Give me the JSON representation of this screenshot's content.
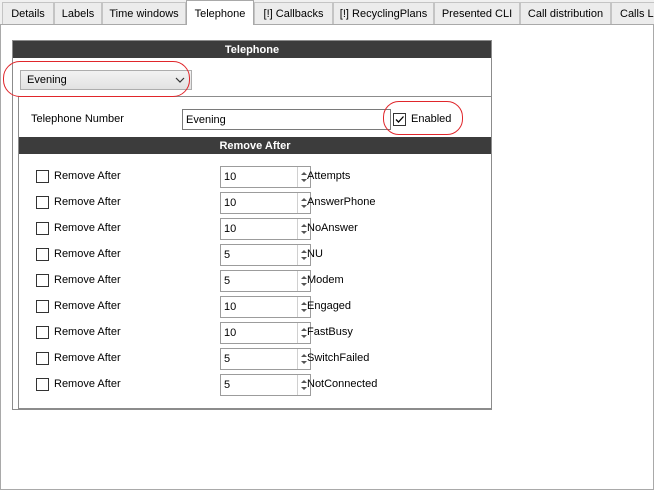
{
  "tabs": [
    {
      "label": "Details"
    },
    {
      "label": "Labels"
    },
    {
      "label": "Time windows"
    },
    {
      "label": "Telephone"
    },
    {
      "label": "[!] Callbacks"
    },
    {
      "label": "[!] RecyclingPlans"
    },
    {
      "label": "Presented CLI"
    },
    {
      "label": "Call distribution"
    },
    {
      "label": "Calls Li"
    }
  ],
  "active_tab": "Telephone",
  "panel": {
    "title": "Telephone",
    "schedule_select": "Evening",
    "telephone_number_label": "Telephone Number",
    "telephone_number_value": "Evening",
    "enabled_label": "Enabled",
    "enabled_checked": true,
    "remove_after_title": "Remove After"
  },
  "remove_after_rows": [
    {
      "label": "Remove After",
      "value": "10",
      "unit": "Attempts"
    },
    {
      "label": "Remove After",
      "value": "10",
      "unit": "AnswerPhone"
    },
    {
      "label": "Remove After",
      "value": "10",
      "unit": "NoAnswer"
    },
    {
      "label": "Remove After",
      "value": "5",
      "unit": "NU"
    },
    {
      "label": "Remove After",
      "value": "5",
      "unit": "Modem"
    },
    {
      "label": "Remove After",
      "value": "10",
      "unit": "Engaged"
    },
    {
      "label": "Remove After",
      "value": "10",
      "unit": "FastBusy"
    },
    {
      "label": "Remove After",
      "value": "5",
      "unit": "SwitchFailed"
    },
    {
      "label": "Remove After",
      "value": "5",
      "unit": "NotConnected"
    }
  ],
  "annotation_color": "#e0262b"
}
